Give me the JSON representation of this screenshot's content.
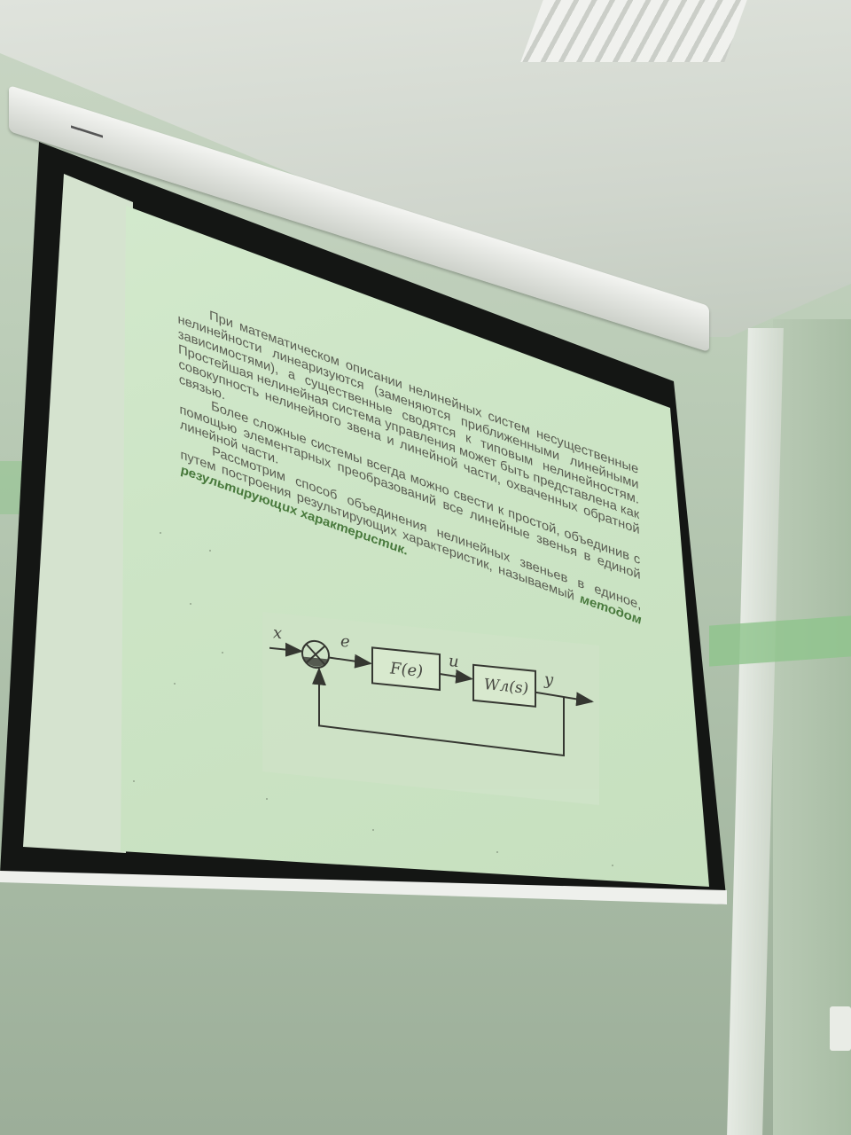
{
  "projector": {
    "brand_label": "▬▬▬▬"
  },
  "slide": {
    "paragraphs": [
      {
        "before": "",
        "text": "При математическом описании нелинейных систем несущественные нелинейности линеаризуются (заменяются приближенными линейными зависимостями), а существенные сводятся к типовым нелинейностям. Простейшая нелинейная система управления может быть представлена как совокупность нелинейного звена и линейной части, охваченных обратной связью.",
        "after": ""
      },
      {
        "before": "",
        "text": "Более сложные системы всегда можно свести к простой, объединив с помощью элементарных преобразований все линейные звенья в единой линейной части.",
        "after": ""
      },
      {
        "before": "",
        "text": "Рассмотрим способ объединения нелинейных звеньев в единое, путем построения результирующих характеристик, называемый ",
        "highlight": "методом результирующих характеристик.",
        "after": ""
      }
    ]
  },
  "diagram": {
    "input_label": "x",
    "error_label": "e",
    "nonlinear_block": "F(e)",
    "control_label": "u",
    "linear_block": "Wл(s)",
    "output_label": "y"
  }
}
